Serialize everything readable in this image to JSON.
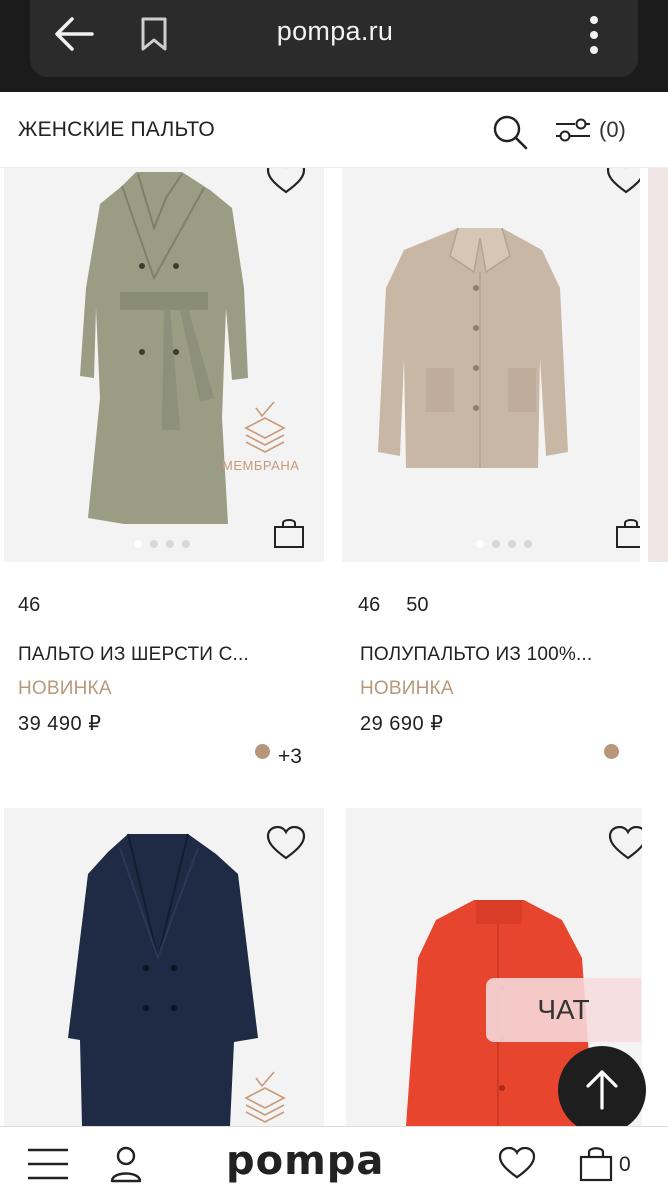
{
  "browser": {
    "url": "pompa.ru"
  },
  "header": {
    "title": "ЖЕНСКИЕ ПАЛЬТО",
    "filter_count": "(0)"
  },
  "products": [
    {
      "sizes": [
        "46"
      ],
      "name": "ПАЛЬТО ИЗ ШЕРСТИ С...",
      "badge": "НОВИНКА",
      "price": "39 490 ₽",
      "more_colors": "+3",
      "swatch_color": "#b7967a",
      "image_color": "#9a9d84",
      "membrane_label": "МЕМБРАНА"
    },
    {
      "sizes": [
        "46",
        "50"
      ],
      "name": "ПОЛУПАЛЬТО ИЗ 100%...",
      "badge": "НОВИНКА",
      "price": "29 690 ₽",
      "swatch_color": "#b7967a",
      "image_color": "#c9b7a6"
    },
    {
      "image_color": "#1f2a44"
    },
    {
      "image_color": "#e8452e"
    }
  ],
  "chat": {
    "label": "ЧАТ"
  },
  "bottom_nav": {
    "logo": "pompa",
    "cart_count": "0"
  },
  "colors": {
    "accent_badge": "#b9987a",
    "browser_bg": "#1b1b1b"
  }
}
